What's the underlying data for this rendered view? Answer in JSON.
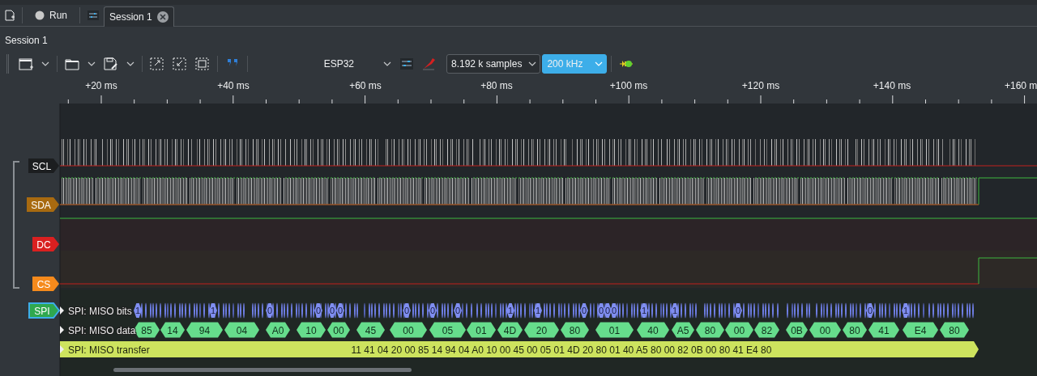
{
  "main_toolbar": {
    "run_button": "Run"
  },
  "tabs": [
    {
      "label": "Session 1",
      "selected": true
    }
  ],
  "session": {
    "title": "Session 1",
    "device": "ESP32",
    "sample_count": "8.192 k samples",
    "sample_rate": "200 kHz"
  },
  "ruler": {
    "ticks": [
      "+20 ms",
      "+40 ms",
      "+60 ms",
      "+80 ms",
      "+100 ms",
      "+120 ms",
      "+140 ms",
      "+160 m"
    ]
  },
  "channels": [
    {
      "name": "SCL",
      "color": "#1c1e20"
    },
    {
      "name": "SDA",
      "color": "#a86a10"
    },
    {
      "name": "DC",
      "color": "#d92020"
    },
    {
      "name": "CS",
      "color": "#f58a1c"
    }
  ],
  "decoder": {
    "name": "SPI",
    "color": "#2fa84f",
    "rows": [
      {
        "kind": "bits",
        "label": "SPI: MISO bits",
        "annotations": [
          "1",
          "1",
          "0",
          "0",
          "0",
          "0",
          "0",
          "0",
          "0",
          "1",
          "1",
          "0",
          "0",
          "0",
          "0",
          "1",
          "1",
          "0",
          "0",
          "1"
        ]
      },
      {
        "kind": "data",
        "label": "SPI: MISO data",
        "annotations": [
          "85",
          "14",
          "94",
          "04",
          "A0",
          "10",
          "00",
          "45",
          "00",
          "05",
          "01",
          "4D",
          "20",
          "80",
          "01",
          "40",
          "A5",
          "80",
          "00",
          "82",
          "0B",
          "00",
          "80",
          "41",
          "E4",
          "80"
        ]
      },
      {
        "kind": "transfer",
        "label": "SPI: MISO transfer",
        "annotations": [
          "11 41 04 20 00 85 14 94 04 A0 10 00 45 00 05 01 4D 20 80 01 40 A5 80 00 82 0B 00 80 41 E4 80"
        ]
      }
    ]
  }
}
